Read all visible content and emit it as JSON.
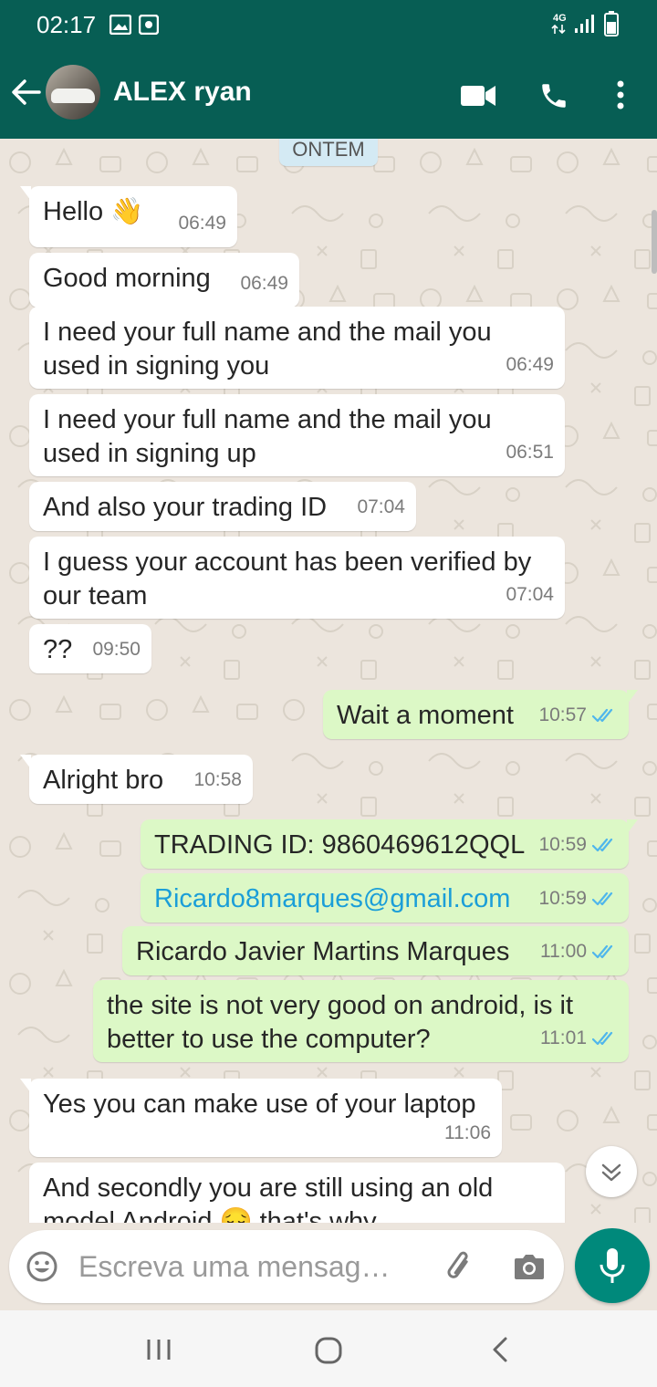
{
  "status_bar": {
    "time": "02:17",
    "network": "4G"
  },
  "header": {
    "contact_name": "ALEX ryan"
  },
  "date_divider": "ONTEM",
  "messages": [
    {
      "text": "Hello 👋",
      "time": "06:49"
    },
    {
      "text": "Good morning",
      "time": "06:49"
    },
    {
      "line1": "I need your full name  and the mail you",
      "line2": "used  in signing you",
      "time": "06:49"
    },
    {
      "line1": "I need your full name  and the mail you",
      "line2": "used  in signing up",
      "time": "06:51"
    },
    {
      "text": "And also your trading ID",
      "time": "07:04"
    },
    {
      "line1": "I guess your account has been verified by",
      "line2": "our team",
      "time": "07:04"
    },
    {
      "text": "??",
      "time": "09:50"
    },
    {
      "text": "Wait a moment",
      "time": "10:57"
    },
    {
      "text": "Alright bro",
      "time": "10:58"
    },
    {
      "text": "TRADING ID: 9860469612QQL",
      "time": "10:59"
    },
    {
      "text": "Ricardo8marques@gmail.com",
      "time": "10:59"
    },
    {
      "text": "Ricardo Javier Martins Marques",
      "time": "11:00"
    },
    {
      "line1": "the site is not very good on android, is it",
      "line2": "better to use the computer?",
      "time": "11:01"
    },
    {
      "text": "Yes you can make use of  your laptop",
      "time": "11:06"
    },
    {
      "line1": "And secondly you are still using an old",
      "line2": "model Android 😔 that's why"
    }
  ],
  "composer": {
    "placeholder": "Escreva uma mensag…"
  },
  "colors": {
    "header": "#075e54",
    "outgoing_bubble": "#dcf8c6",
    "incoming_bubble": "#ffffff",
    "read_ticks": "#4fb6ec",
    "mic_button": "#00897b",
    "link": "#1b9ed8"
  },
  "icons": [
    "back-arrow-icon",
    "video-call-icon",
    "phone-icon",
    "more-vert-icon",
    "emoji-icon",
    "attach-icon",
    "camera-icon",
    "mic-icon",
    "scroll-down-icon",
    "recents-icon",
    "home-icon",
    "back-nav-icon"
  ]
}
